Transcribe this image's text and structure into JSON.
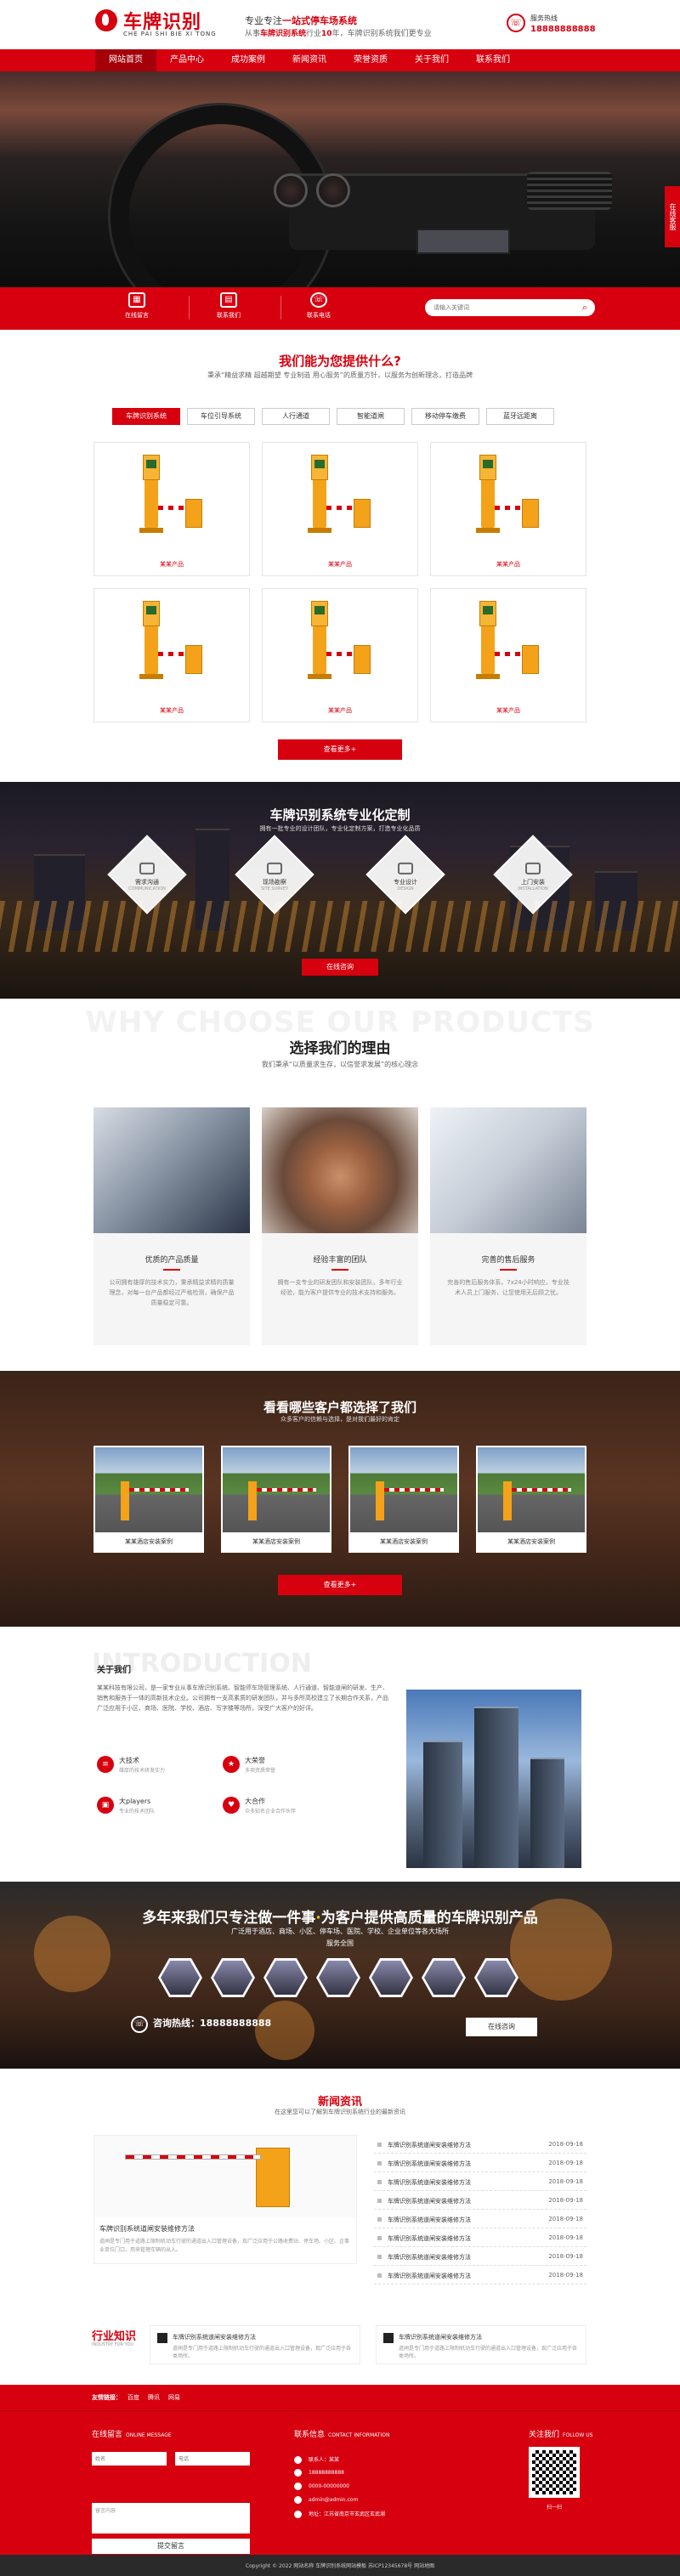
{
  "header": {
    "logo_cn": "车牌识别",
    "logo_py": "CHE PAI SHI BIE XI TONG",
    "slogan1_pre": "专业专注",
    "slogan1_hl": "一站式停车场系统",
    "slogan2_pre": "从事",
    "slogan2_hl": "车牌识别系统",
    "slogan2_mid": "行业",
    "slogan2_years": "10",
    "slogan2_post": "年，车牌识别系统我们更专业",
    "phone_label": "服务热线",
    "phone": "18888888888"
  },
  "nav": {
    "items": [
      "网站首页",
      "产品中心",
      "成功案例",
      "新闻资讯",
      "荣誉资质",
      "关于我们",
      "联系我们"
    ]
  },
  "banner": {
    "side_tab": "在线客服"
  },
  "quick": {
    "items": [
      "在线留言",
      "联系我们",
      "联系电话"
    ],
    "search_placeholder": "请输入关键词"
  },
  "services": {
    "title": "我们能为您提供什么?",
    "subtitle": "秉承“精益求精 超越期望 专业制造 用心服务”的质量方针，以服务为创新理念，打造品牌",
    "tabs": [
      "车牌识别系统",
      "车位引导系统",
      "人行通道",
      "智能道闸",
      "移动停车缴费",
      "蓝牙远距离"
    ],
    "products": [
      "某某产品",
      "某某产品",
      "某某产品",
      "某某产品",
      "某某产品",
      "某某产品"
    ],
    "more": "查看更多+"
  },
  "custom": {
    "title": "车牌识别系统专业化定制",
    "subtitle": "拥有一批专业的设计团队，专业化定制方案，打造专业化品质",
    "items": [
      {
        "name": "需求沟通",
        "en": "COMMUNICATION"
      },
      {
        "name": "现场勘察",
        "en": "SITE SURVEY"
      },
      {
        "name": "专业设计",
        "en": "DESIGN"
      },
      {
        "name": "上门安装",
        "en": "INSTALLATION"
      }
    ],
    "button": "在线咨询"
  },
  "why": {
    "en": "WHY CHOOSE OUR PRODUCTS",
    "title": "选择我们的理由",
    "subtitle": "我们秉承“以质量求生存，以信誉求发展”的核心理念",
    "cards": [
      {
        "title": "优质的产品质量",
        "text": "公司拥有雄厚的技术实力，秉承精益求精的质量理念，对每一台产品都经过严格检测，确保产品质量稳定可靠。"
      },
      {
        "title": "经验丰富的团队",
        "text": "拥有一支专业的研发团队和安装团队，多年行业经验，能为客户提供专业的技术支持和服务。"
      },
      {
        "title": "完善的售后服务",
        "text": "完善的售后服务体系，7x24小时响应，专业技术人员上门服务，让您使用无后顾之忧。"
      }
    ]
  },
  "cases": {
    "title": "看看哪些客户都选择了我们",
    "subtitle": "众多客户的信赖与选择，是对我们最好的肯定",
    "items": [
      "某某酒店安装案例",
      "某某酒店安装案例",
      "某某酒店安装案例",
      "某某酒店安装案例"
    ],
    "more": "查看更多+"
  },
  "intro": {
    "en": "INTRODUCTION",
    "title": "关于我们",
    "text": "某某科技有限公司，是一家专业从事车牌识别系统、智能停车场管理系统、人行通道、智能道闸的研发、生产、销售和服务于一体的高新技术企业。公司拥有一支高素质的研发团队，并与多所高校建立了长期合作关系，产品广泛应用于小区、商场、医院、学校、酒店、写字楼等场所，深受广大客户的好评。",
    "features": [
      {
        "name": "大技术",
        "desc": "雄厚的技术研发实力",
        "icon": "≡"
      },
      {
        "name": "大荣誉",
        "desc": "多项资质荣誉",
        "icon": "★"
      },
      {
        "name": "大players",
        "desc": "专业的技术团队",
        "icon": "▣"
      },
      {
        "name": "大合作",
        "desc": "众多知名企业合作伙伴",
        "icon": "♥"
      }
    ]
  },
  "focus": {
    "title_pre": "多年来我们只专注做一件事",
    "title_hl": "·",
    "title_post": "为客户提供高质量的车牌识别产品",
    "sub1": "广泛用于酒店、商场、小区、停车场、医院、学校、企业单位等各大场所",
    "sub2": "服务全国",
    "phone_label": "咨询热线：",
    "phone": "18888888888",
    "button": "在线咨询"
  },
  "news": {
    "title": "新闻资讯",
    "subtitle": "在这里您可以了解到车牌识别系统行业的最新资讯",
    "feature_title": "车牌识别系统道闸安装维修方法",
    "feature_text": "道闸是专门用于道路上限制机动车行驶的通道出入口管理设备，现广泛应用于公路收费站、停车场、小区、企事业单位门口，用来管理车辆的出入。",
    "list": [
      {
        "t": "车牌识别系统道闸安装维修方法",
        "d": "2018-09-18"
      },
      {
        "t": "车牌识别系统道闸安装维修方法",
        "d": "2018-09-18"
      },
      {
        "t": "车牌识别系统道闸安装维修方法",
        "d": "2018-09-18"
      },
      {
        "t": "车牌识别系统道闸安装维修方法",
        "d": "2018-09-18"
      },
      {
        "t": "车牌识别系统道闸安装维修方法",
        "d": "2018-09-18"
      },
      {
        "t": "车牌识别系统道闸安装维修方法",
        "d": "2018-09-18"
      },
      {
        "t": "车牌识别系统道闸安装维修方法",
        "d": "2018-09-18"
      },
      {
        "t": "车牌识别系统道闸安装维修方法",
        "d": "2018-09-18"
      }
    ],
    "industry_title": "行业知识",
    "industry_en": "INDUSTRY FOR YOU",
    "industry_items": [
      {
        "t": "车牌识别系统道闸安装维修方法",
        "x": "道闸是专门用于道路上限制机动车行驶的通道出入口管理设备，现广泛应用于各类场所。"
      },
      {
        "t": "车牌识别系统道闸安装维修方法",
        "x": "道闸是专门用于道路上限制机动车行驶的通道出入口管理设备，现广泛应用于各类场所。"
      }
    ]
  },
  "links": {
    "label": "友情链接：",
    "items": [
      "百度",
      "腾讯",
      "网易"
    ]
  },
  "footer": {
    "msg_title": "在线留言",
    "msg_en": "ONLINE MESSAGE",
    "name_ph": "姓名",
    "phone_ph": "电话",
    "content_ph": "留言内容",
    "submit": "提交留言",
    "contact_title": "联系信息",
    "contact_en": "CONTACT INFORMATION",
    "contact_rows": [
      "联系人：某某",
      "18888888888",
      "0000-00000000",
      "admin@admin.com",
      "地址：江苏省南京市玄武区玄武湖"
    ],
    "follow_title": "关注我们",
    "follow_en": "FOLLOW US",
    "qr_label": "扫一扫"
  },
  "copyright": "Copyright © 2022 网站名称 车牌识别系统网站模板 苏ICP12345678号 网站地图"
}
